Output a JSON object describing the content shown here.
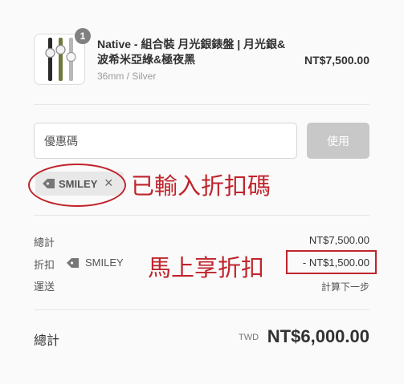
{
  "product": {
    "quantity": "1",
    "name": "Native - 組合裝 月光銀錶盤 | 月光銀&波希米亞綠&極夜黑",
    "variant": "36mm / Silver",
    "price": "NT$7,500.00"
  },
  "discount": {
    "placeholder": "優惠碼",
    "apply_label": "使用",
    "applied_code": "SMILEY",
    "close_icon": "×",
    "annotation": "已輸入折扣碼"
  },
  "summary": {
    "subtotal_label": "總計",
    "subtotal_value": "NT$7,500.00",
    "discount_label": "折扣",
    "discount_code": "SMILEY",
    "discount_value": "- NT$1,500.00",
    "discount_annotation": "馬上享折扣",
    "shipping_label": "運送",
    "shipping_value": "計算下一步"
  },
  "total": {
    "label": "總計",
    "currency": "TWD",
    "amount": "NT$6,000.00"
  },
  "colors": {
    "annotation": "#c0242c",
    "apply_button": "#c8c8c8"
  }
}
